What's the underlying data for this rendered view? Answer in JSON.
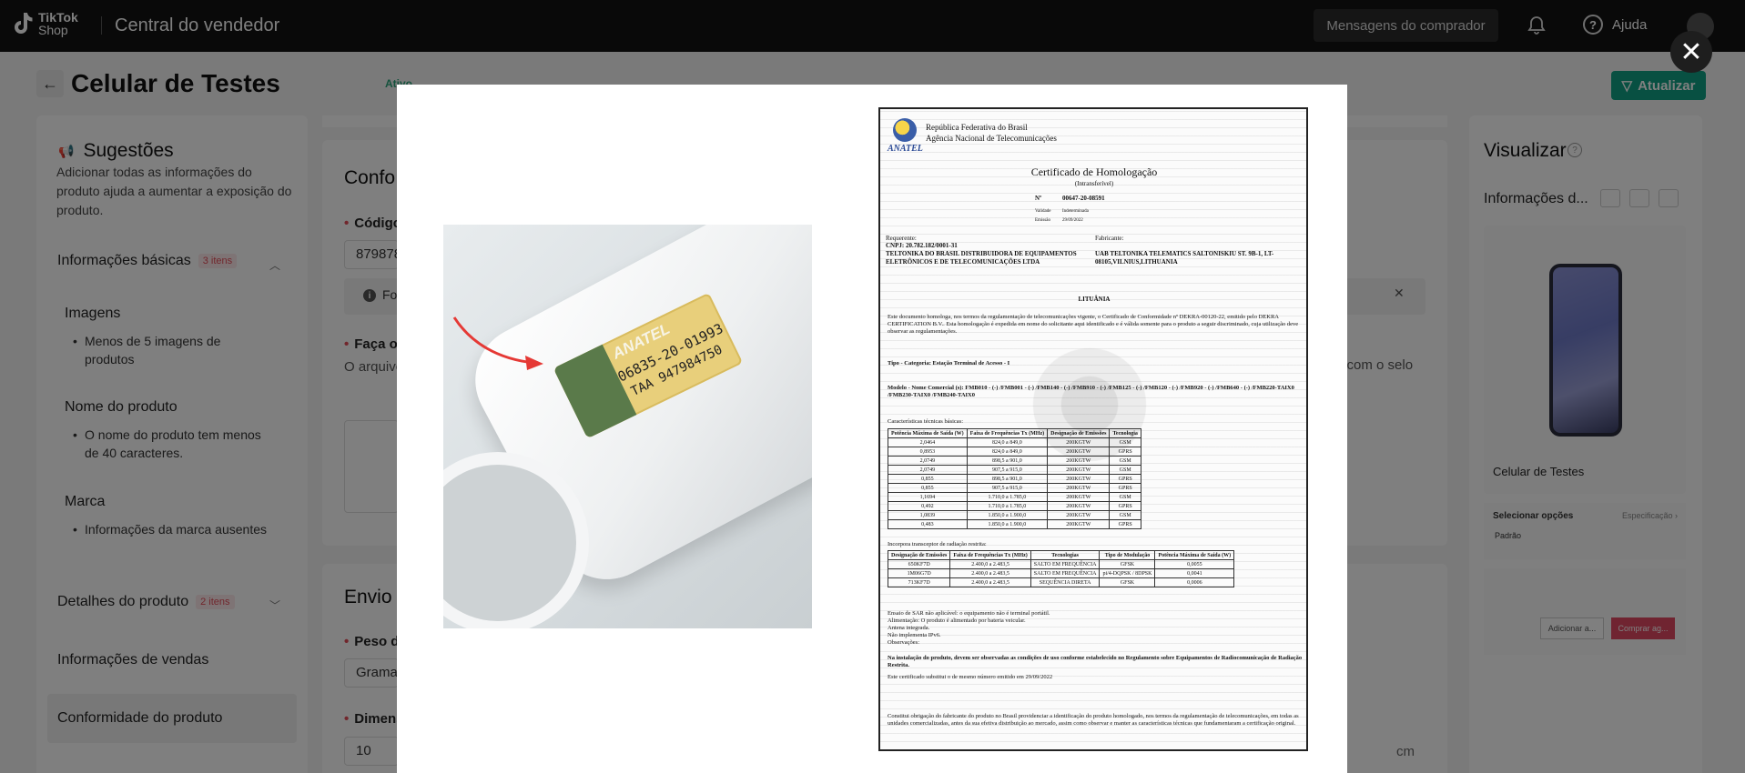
{
  "topbar": {
    "logo_line1": "TikTok",
    "logo_line2": "Shop",
    "app_title": "Central do vendedor",
    "messages_label": "Mensagens do comprador",
    "help_label": "Ajuda"
  },
  "page": {
    "title": "Celular de Testes",
    "status": "Ativo",
    "update_label": "Atualizar"
  },
  "suggestions": {
    "title": "Sugestões",
    "description": "Adicionar todas as informações do produto ajuda a aumentar a exposição do produto.",
    "sections": [
      {
        "label": "Informações básicas",
        "badge": "3 itens"
      },
      {
        "label": "Detalhes do produto",
        "badge": "2 itens"
      },
      {
        "label": "Informações de vendas"
      },
      {
        "label": "Conformidade do produto"
      }
    ],
    "groups": [
      {
        "heading": "Imagens",
        "item": "Menos de 5 imagens de produtos"
      },
      {
        "heading": "Nome do produto",
        "item": "O nome do produto tem menos de 40 caracteres."
      },
      {
        "heading": "Marca",
        "item": "Informações da marca ausentes"
      }
    ]
  },
  "main": {
    "section1_title": "Confo",
    "code_label": "Códigc",
    "code_value": "879878",
    "info_text": "Fo",
    "photo_label": "Faça o",
    "para": "O arquivo da ANATE https://in",
    "para_right": "o com o selo",
    "section2_title": "Envio",
    "weight_label": "Peso d",
    "weight_value": "Gramas",
    "dim_label": "Dimens",
    "dim_value": "10",
    "unit": "cm"
  },
  "preview": {
    "title": "Visualizar",
    "subtitle": "Informações d...",
    "product_name": "Celular de Testes",
    "select_options": "Selecionar opções",
    "spec_link": "Especificação ›",
    "default_option": "Padrão",
    "add_cart": "Adicionar a...",
    "buy": "Comprar ag..."
  },
  "modal": {
    "close_icon": "close-icon",
    "adapter_label": {
      "brand": "ANATEL",
      "line1": "06835-20-01993",
      "line2": "TAA 947984750"
    },
    "certificate": {
      "header_line1": "República Federativa do Brasil",
      "header_line2": "Agência Nacional de Telecomunicações",
      "logo_text": "ANATEL",
      "title": "Certificado de Homologação",
      "subtitle": "(Intransferível)",
      "number_label": "Nº",
      "number": "00647-20-08591",
      "validity_label": "Validade",
      "validity": "Indeterminada",
      "emission_label": "Emissão",
      "emission": "29/09/2022",
      "requester_label": "Requerente:",
      "manufacturer_label": "Fabricante:",
      "cnpj": "CNPJ: 20.782.182/0001-31",
      "requester": "TELTONIKA DO BRASIL DISTRIBUIDORA DE EQUIPAMENTOS ELETRÔNICOS E DE TELECOMUNICAÇÕES LTDA",
      "manufacturer": "UAB TELTONIKA TELEMATICS SALTONISKIU ST. 9B-1, LT-08105,VILNIUS,LITHUANIA",
      "country": "LITUÂNIA",
      "body": "Este documento homologa, nos termos da regulamentação de telecomunicações vigente, o Certificado de Conformidade nº DEKRA-00120-22, emitido pelo DEKRA CERTIFICATION B.V.. Esta homologação é expedida em nome do solicitante aqui identificado e é válida somente para o produto a seguir discriminado, cuja utilização deve observar as regulamentações.",
      "type": "Tipo - Categoria: Estação Terminal de Acesso - I",
      "models": "Modelo - Nome Comercial (s): FMB010 - (-) /FMB001 - (-) /FMB140 - (-) /FMB910 - (-) /FMB125 - (-) /FMB120 - (-) /FMB920 - (-) /FMB640 - (-) /FMB220-TAIX0 /FMB230-TAIX0 /FMB240-TAIX0",
      "tech_label": "Características técnicas básicas:",
      "table1_headers": [
        "Potência Máxima de Saída (W)",
        "Faixa de Frequências Tx (MHz)",
        "Designação de Emissões",
        "Tecnologia"
      ],
      "table1_rows": [
        [
          "2,0464",
          "824,0 a 849,0",
          "200KGTW",
          "GSM"
        ],
        [
          "0,8953",
          "824,0 a 849,0",
          "200KGTW",
          "GPRS"
        ],
        [
          "2,0749",
          "898,5 a 901,0",
          "200KGTW",
          "GSM"
        ],
        [
          "2,0749",
          "907,5 a 915,0",
          "200KGTW",
          "GSM"
        ],
        [
          "0,855",
          "898,5 a 901,0",
          "200KGTW",
          "GPRS"
        ],
        [
          "0,855",
          "907,5 a 915,0",
          "200KGTW",
          "GPRS"
        ],
        [
          "1,1694",
          "1.710,0 a 1.785,0",
          "200KGTW",
          "GSM"
        ],
        [
          "0,492",
          "1.710,0 a 1.785,0",
          "200KGTW",
          "GPRS"
        ],
        [
          "1,0839",
          "1.850,0 a 1.900,0",
          "200KGTW",
          "GSM"
        ],
        [
          "0,483",
          "1.850,0 a 1.900,0",
          "200KGTW",
          "GPRS"
        ]
      ],
      "restricted_label": "Incorpora transceptor de radiação restrita:",
      "table2_headers": [
        "Designação de Emissões",
        "Faixa de Frequências Tx (MHz)",
        "Tecnologias",
        "Tipo de Modulação",
        "Potência Máxima de Saída (W)"
      ],
      "table2_rows": [
        [
          "650KF7D",
          "2.400,0 a 2.483,5",
          "SALTO EM FREQUÊNCIA",
          "GFSK",
          "0,0055"
        ],
        [
          "1M06G7D",
          "2.400,0 a 2.483,5",
          "SALTO EM FREQUÊNCIA",
          "pi/4-DQPSK / 8DPSK",
          "0,0041"
        ],
        [
          "713KF7D",
          "2.400,0 a 2.483,5",
          "SEQUÊNCIA DIRETA",
          "GFSK",
          "0,0006"
        ]
      ],
      "notes": [
        "Ensaio de SAR não aplicável: o equipamento não é terminal portátil.",
        "Alimentação: O produto é alimentado por bateria veicular.",
        "Antena integrada.",
        "Não implementa IPv6.",
        "Observações:"
      ],
      "install_note": "Na instalação do produto, devem ser observadas as condições de uso conforme estabelecido no Regulamento sobre Equipamentos de Radiocomunicação de Radiação Restrita.",
      "replaces": "Este certificado substitui o de mesmo número emitido em 29/09/2022",
      "footer": "Constitui obrigação do fabricante do produto no Brasil providenciar a identificação do produto homologado, nos termos da regulamentação de telecomunicações, em todas as unidades comercializadas, antes da sua efetiva distribuição ao mercado, assim como observar e manter as características técnicas que fundamentaram a certificação original."
    }
  }
}
